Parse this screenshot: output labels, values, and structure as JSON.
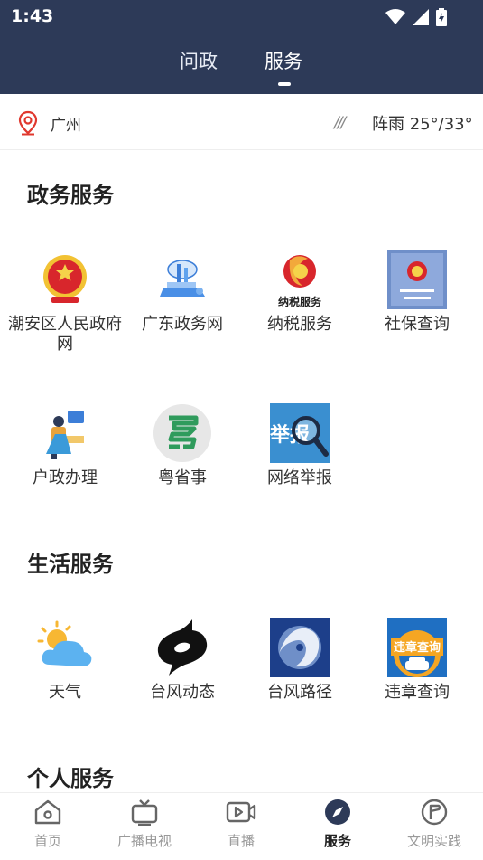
{
  "status": {
    "time": "1:43"
  },
  "header": {
    "tabs": [
      {
        "label": "问政"
      },
      {
        "label": "服务",
        "active": true
      }
    ]
  },
  "location": {
    "city": "广州",
    "weather_icon": "rain-lines-icon",
    "weather": "阵雨 25°/33°"
  },
  "sections": [
    {
      "title": "政务服务",
      "items": [
        {
          "label": "潮安区人民政府网",
          "icon": "national-emblem-icon"
        },
        {
          "label": "广东政务网",
          "icon": "cloud-laptop-icon"
        },
        {
          "label": "纳税服务",
          "icon": "tax-service-logo-icon",
          "logo_text": "纳税服务"
        },
        {
          "label": "社保查询",
          "icon": "social-security-card-icon"
        },
        {
          "label": "户政办理",
          "icon": "household-registration-icon"
        },
        {
          "label": "粤省事",
          "icon": "yue-sheng-shi-icon"
        },
        {
          "label": "网络举报",
          "icon": "report-magnifier-icon",
          "logo_text": "举报"
        }
      ]
    },
    {
      "title": "生活服务",
      "items": [
        {
          "label": "天气",
          "icon": "weather-sun-cloud-icon"
        },
        {
          "label": "台风动态",
          "icon": "typhoon-symbol-icon"
        },
        {
          "label": "台风路径",
          "icon": "typhoon-satellite-icon"
        },
        {
          "label": "违章查询",
          "icon": "traffic-violation-icon",
          "logo_text": "违章查询"
        }
      ]
    },
    {
      "title": "个人服务",
      "items": []
    }
  ],
  "bottom_nav": [
    {
      "label": "首页",
      "icon": "home-icon"
    },
    {
      "label": "广播电视",
      "icon": "tv-icon"
    },
    {
      "label": "直播",
      "icon": "live-video-icon"
    },
    {
      "label": "服务",
      "icon": "compass-icon",
      "active": true
    },
    {
      "label": "文明实践",
      "icon": "flag-badge-icon"
    }
  ],
  "colors": {
    "header": "#2d3a58",
    "accent_red": "#e0382e",
    "nav_active": "#2d3a58"
  }
}
